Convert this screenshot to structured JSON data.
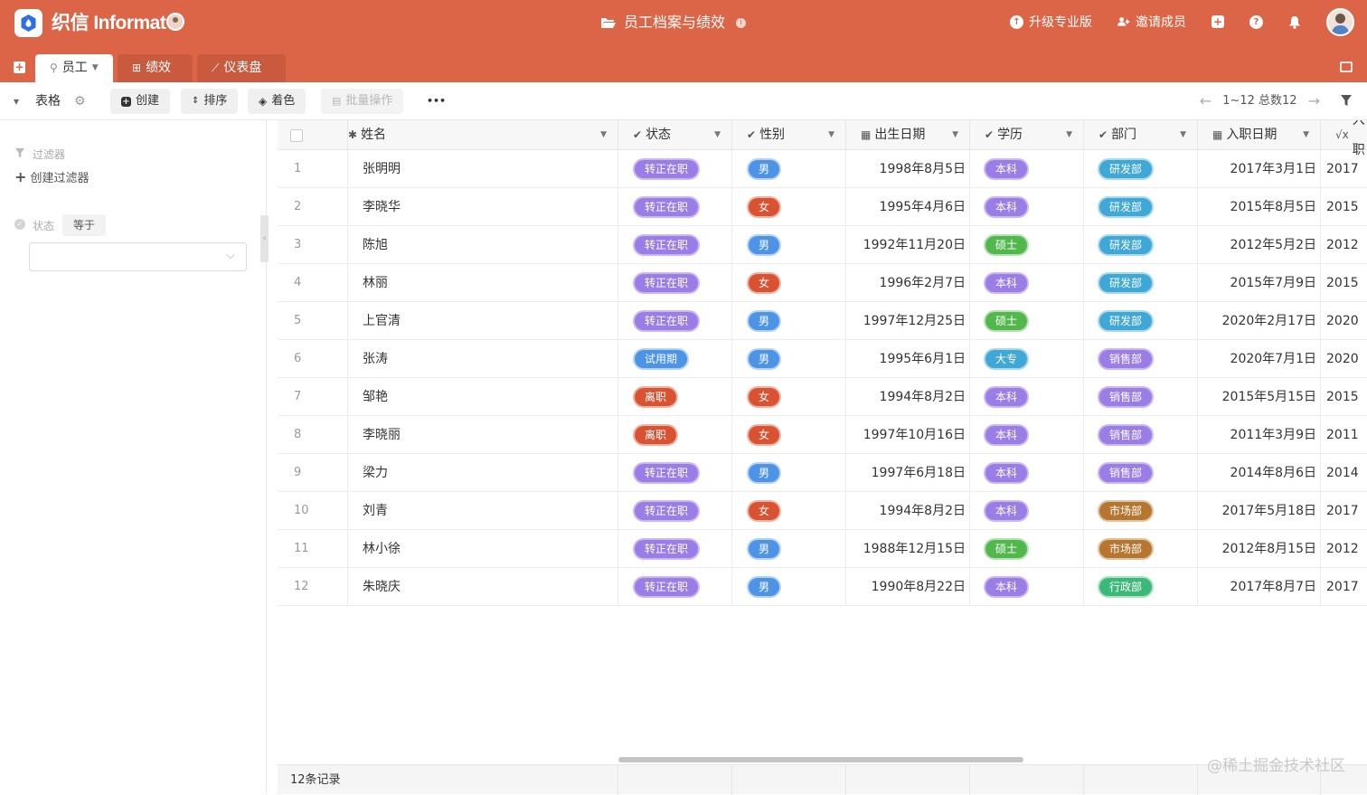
{
  "header": {
    "brand": "织信 Informat",
    "doc_title": "员工档案与绩效",
    "actions": [
      {
        "label": "升级专业版",
        "icon": "upgrade-icon"
      },
      {
        "label": "邀请成员",
        "icon": "add-user-icon"
      }
    ]
  },
  "tabs": [
    {
      "label": "员工",
      "icon": "person-icon",
      "active": true
    },
    {
      "label": "绩效",
      "icon": "table-icon",
      "active": false
    },
    {
      "label": "仪表盘",
      "icon": "chart-icon",
      "active": false
    }
  ],
  "toolbar": {
    "view_label": "表格",
    "create_label": "创建",
    "sort_label": "排序",
    "color_label": "着色",
    "batch_label": "批量操作",
    "more_label": "•••",
    "pagination": "1~12 总数12"
  },
  "sidebar": {
    "filter_title": "过滤器",
    "create_filter": "创建过滤器",
    "condition_field": "状态",
    "condition_op": "等于",
    "condition_value": ""
  },
  "table": {
    "columns": [
      {
        "label": "姓名",
        "icon": "asterisk-icon"
      },
      {
        "label": "状态",
        "icon": "check-circle-icon"
      },
      {
        "label": "性别",
        "icon": "check-circle-icon"
      },
      {
        "label": "出生日期",
        "icon": "calendar-icon"
      },
      {
        "label": "学历",
        "icon": "check-circle-icon"
      },
      {
        "label": "部门",
        "icon": "check-circle-icon"
      },
      {
        "label": "入职日期",
        "icon": "calendar-icon"
      },
      {
        "label": "入职",
        "icon": "formula-icon"
      }
    ],
    "rows": [
      {
        "no": "1",
        "name": "张明明",
        "status": "转正在职",
        "gender": "男",
        "birth": "1998年8月5日",
        "edu": "本科",
        "dept": "研发部",
        "hire": "2017年3月1日",
        "extra": "2017"
      },
      {
        "no": "2",
        "name": "李晓华",
        "status": "转正在职",
        "gender": "女",
        "birth": "1995年4月6日",
        "edu": "本科",
        "dept": "研发部",
        "hire": "2015年8月5日",
        "extra": "2015"
      },
      {
        "no": "3",
        "name": "陈旭",
        "status": "转正在职",
        "gender": "男",
        "birth": "1992年11月20日",
        "edu": "硕士",
        "dept": "研发部",
        "hire": "2012年5月2日",
        "extra": "2012"
      },
      {
        "no": "4",
        "name": "林丽",
        "status": "转正在职",
        "gender": "女",
        "birth": "1996年2月7日",
        "edu": "本科",
        "dept": "研发部",
        "hire": "2015年7月9日",
        "extra": "2015"
      },
      {
        "no": "5",
        "name": "上官清",
        "status": "转正在职",
        "gender": "男",
        "birth": "1997年12月25日",
        "edu": "硕士",
        "dept": "研发部",
        "hire": "2020年2月17日",
        "extra": "2020"
      },
      {
        "no": "6",
        "name": "张涛",
        "status": "试用期",
        "gender": "男",
        "birth": "1995年6月1日",
        "edu": "大专",
        "dept": "销售部",
        "hire": "2020年7月1日",
        "extra": "2020"
      },
      {
        "no": "7",
        "name": "邹艳",
        "status": "离职",
        "gender": "女",
        "birth": "1994年8月2日",
        "edu": "本科",
        "dept": "销售部",
        "hire": "2015年5月15日",
        "extra": "2015"
      },
      {
        "no": "8",
        "name": "李晓丽",
        "status": "离职",
        "gender": "女",
        "birth": "1997年10月16日",
        "edu": "本科",
        "dept": "销售部",
        "hire": "2011年3月9日",
        "extra": "2011"
      },
      {
        "no": "9",
        "name": "梁力",
        "status": "转正在职",
        "gender": "男",
        "birth": "1997年6月18日",
        "edu": "本科",
        "dept": "销售部",
        "hire": "2014年8月6日",
        "extra": "2014"
      },
      {
        "no": "10",
        "name": "刘青",
        "status": "转正在职",
        "gender": "女",
        "birth": "1994年8月2日",
        "edu": "本科",
        "dept": "市场部",
        "hire": "2017年5月18日",
        "extra": "2017"
      },
      {
        "no": "11",
        "name": "林小徐",
        "status": "转正在职",
        "gender": "男",
        "birth": "1988年12月15日",
        "edu": "硕士",
        "dept": "市场部",
        "hire": "2012年8月15日",
        "extra": "2012"
      },
      {
        "no": "12",
        "name": "朱晓庆",
        "status": "转正在职",
        "gender": "男",
        "birth": "1990年8月22日",
        "edu": "本科",
        "dept": "行政部",
        "hire": "2017年8月7日",
        "extra": "2017"
      }
    ],
    "footer_count": "12条记录"
  },
  "watermark": "@稀土掘金技术社区",
  "colors": {
    "header_bg": "#dc6547",
    "status": {
      "转正在职": "#9b7de6",
      "试用期": "#4d93e6",
      "离职": "#d95333"
    },
    "gender": {
      "男": "#4d93e6",
      "女": "#d95333"
    },
    "edu": {
      "本科": "#9b7de6",
      "硕士": "#52b84d",
      "大专": "#3fa8d6"
    },
    "dept": {
      "研发部": "#3fa8d6",
      "销售部": "#9b7de6",
      "市场部": "#b7762f",
      "行政部": "#3cb978"
    }
  }
}
